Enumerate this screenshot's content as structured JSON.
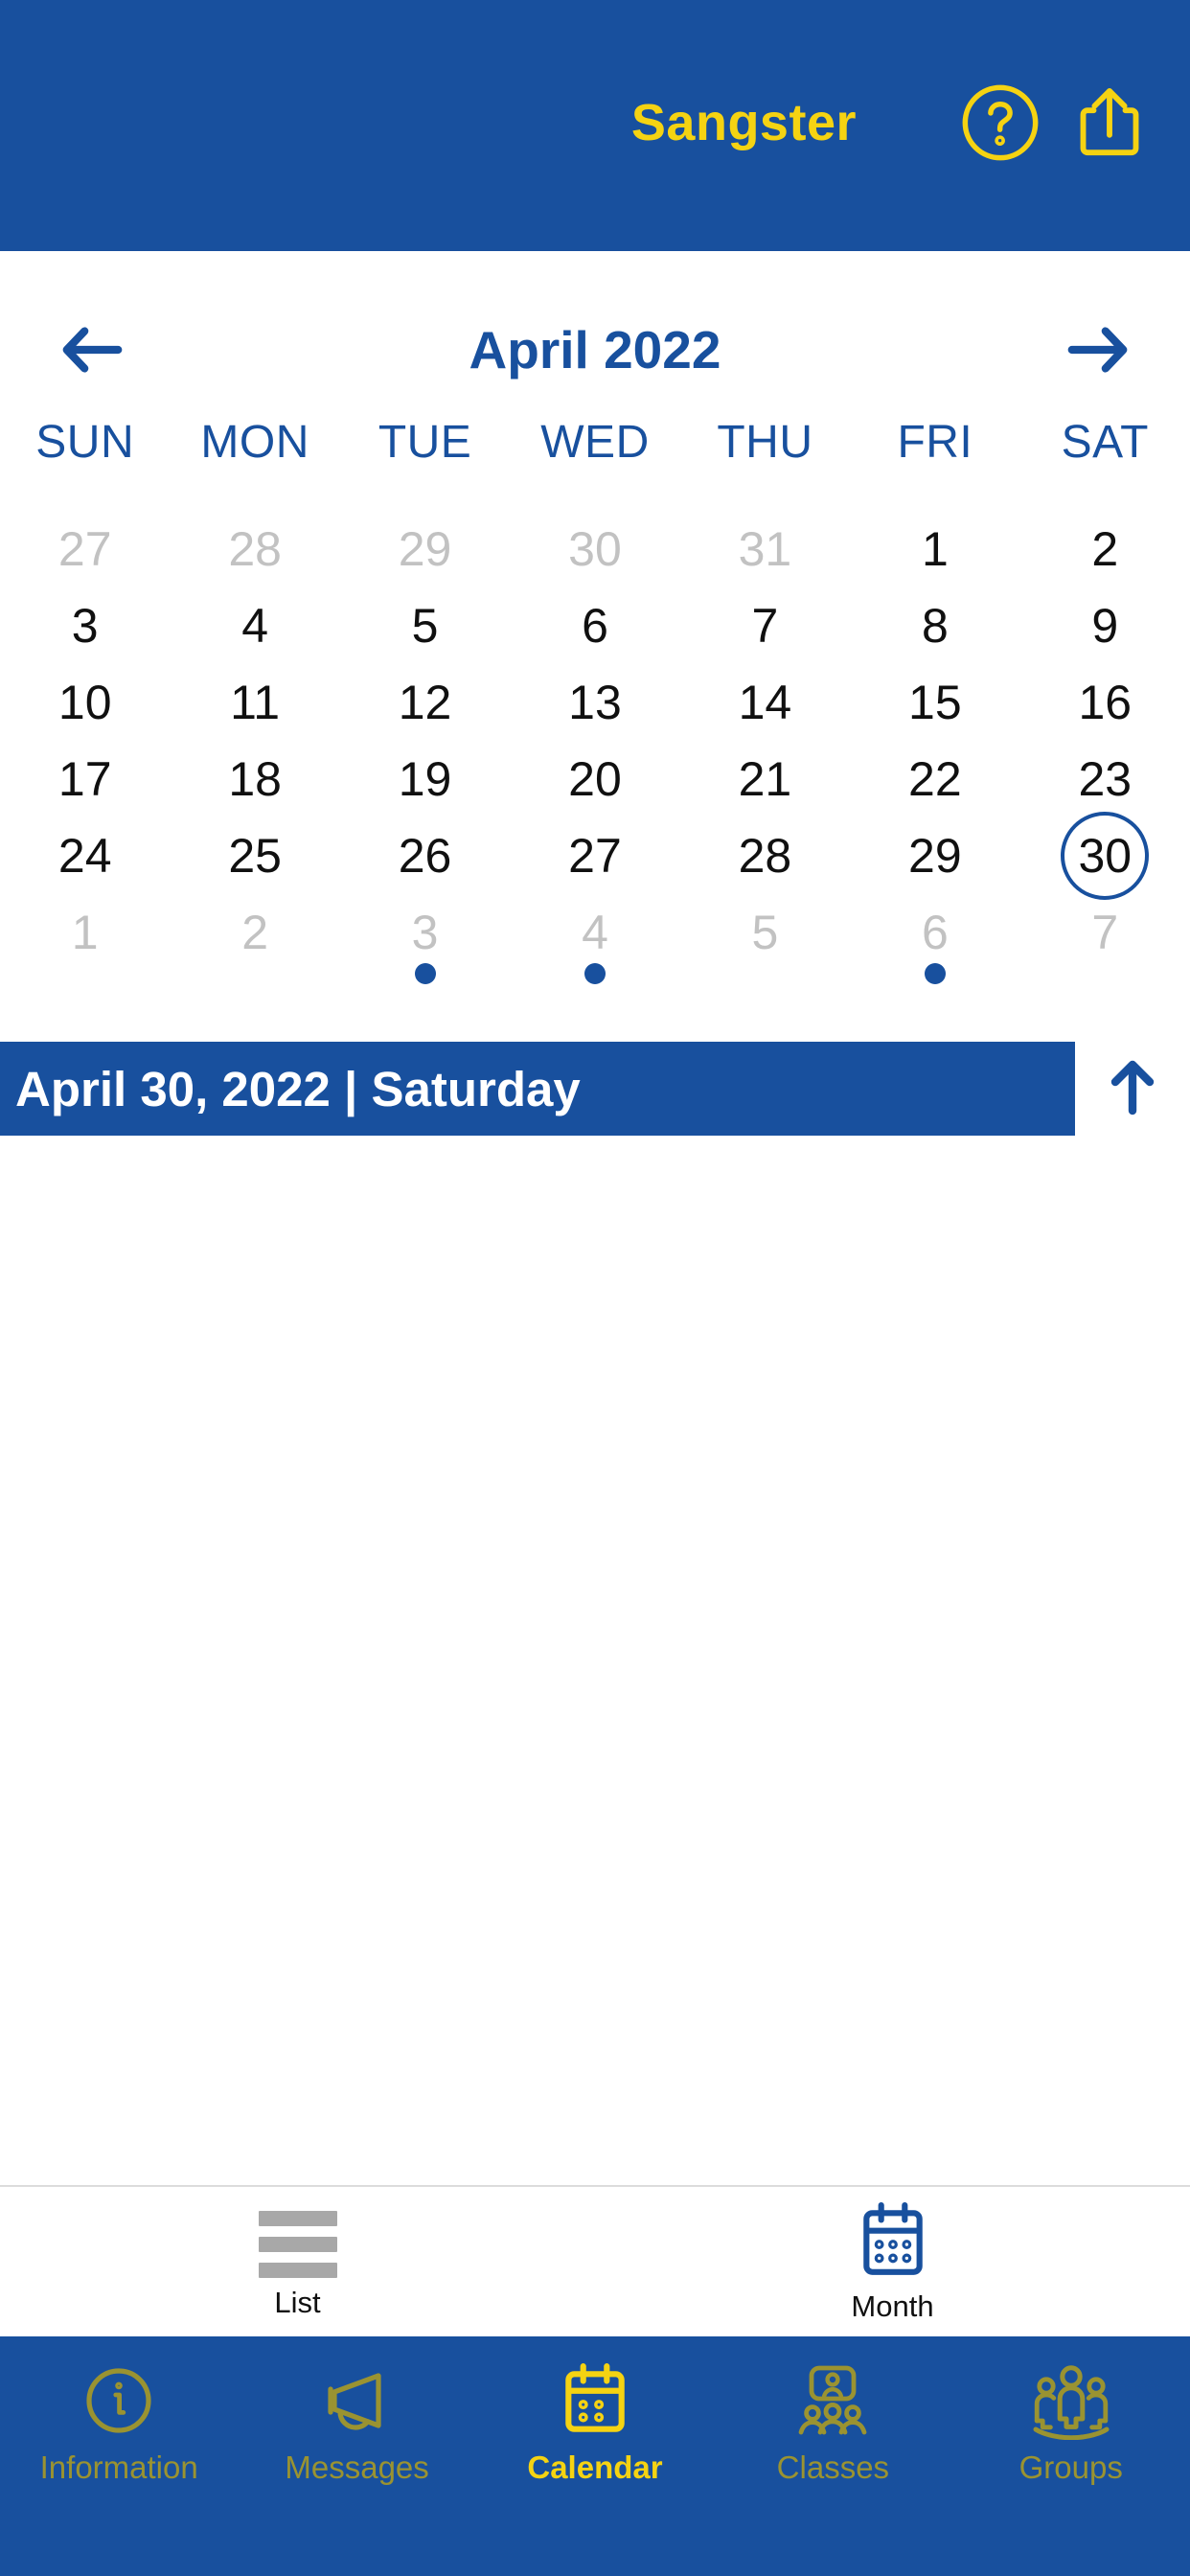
{
  "header": {
    "title": "Sangster",
    "help_icon": "help-circle-icon",
    "share_icon": "share-icon",
    "background_color": "#18509E",
    "accent_color": "#F5D312"
  },
  "calendar": {
    "month_title": "April 2022",
    "prev_label": "←",
    "next_label": "→",
    "weekdays": [
      "SUN",
      "MON",
      "TUE",
      "WED",
      "THU",
      "FRI",
      "SAT"
    ],
    "accent_color": "#18509E",
    "muted_color": "#C2C2C2",
    "weeks": [
      [
        {
          "n": "27",
          "muted": true,
          "selected": false,
          "dot": false
        },
        {
          "n": "28",
          "muted": true,
          "selected": false,
          "dot": false
        },
        {
          "n": "29",
          "muted": true,
          "selected": false,
          "dot": false
        },
        {
          "n": "30",
          "muted": true,
          "selected": false,
          "dot": false
        },
        {
          "n": "31",
          "muted": true,
          "selected": false,
          "dot": false
        },
        {
          "n": "1",
          "muted": false,
          "selected": false,
          "dot": false
        },
        {
          "n": "2",
          "muted": false,
          "selected": false,
          "dot": false
        }
      ],
      [
        {
          "n": "3",
          "muted": false,
          "selected": false,
          "dot": false
        },
        {
          "n": "4",
          "muted": false,
          "selected": false,
          "dot": false
        },
        {
          "n": "5",
          "muted": false,
          "selected": false,
          "dot": false
        },
        {
          "n": "6",
          "muted": false,
          "selected": false,
          "dot": false
        },
        {
          "n": "7",
          "muted": false,
          "selected": false,
          "dot": false
        },
        {
          "n": "8",
          "muted": false,
          "selected": false,
          "dot": false
        },
        {
          "n": "9",
          "muted": false,
          "selected": false,
          "dot": false
        }
      ],
      [
        {
          "n": "10",
          "muted": false,
          "selected": false,
          "dot": false
        },
        {
          "n": "11",
          "muted": false,
          "selected": false,
          "dot": false
        },
        {
          "n": "12",
          "muted": false,
          "selected": false,
          "dot": false
        },
        {
          "n": "13",
          "muted": false,
          "selected": false,
          "dot": false
        },
        {
          "n": "14",
          "muted": false,
          "selected": false,
          "dot": false
        },
        {
          "n": "15",
          "muted": false,
          "selected": false,
          "dot": false
        },
        {
          "n": "16",
          "muted": false,
          "selected": false,
          "dot": false
        }
      ],
      [
        {
          "n": "17",
          "muted": false,
          "selected": false,
          "dot": false
        },
        {
          "n": "18",
          "muted": false,
          "selected": false,
          "dot": false
        },
        {
          "n": "19",
          "muted": false,
          "selected": false,
          "dot": false
        },
        {
          "n": "20",
          "muted": false,
          "selected": false,
          "dot": false
        },
        {
          "n": "21",
          "muted": false,
          "selected": false,
          "dot": false
        },
        {
          "n": "22",
          "muted": false,
          "selected": false,
          "dot": false
        },
        {
          "n": "23",
          "muted": false,
          "selected": false,
          "dot": false
        }
      ],
      [
        {
          "n": "24",
          "muted": false,
          "selected": false,
          "dot": false
        },
        {
          "n": "25",
          "muted": false,
          "selected": false,
          "dot": false
        },
        {
          "n": "26",
          "muted": false,
          "selected": false,
          "dot": false
        },
        {
          "n": "27",
          "muted": false,
          "selected": false,
          "dot": false
        },
        {
          "n": "28",
          "muted": false,
          "selected": false,
          "dot": false
        },
        {
          "n": "29",
          "muted": false,
          "selected": false,
          "dot": false
        },
        {
          "n": "30",
          "muted": false,
          "selected": true,
          "dot": false
        }
      ],
      [
        {
          "n": "1",
          "muted": true,
          "selected": false,
          "dot": false
        },
        {
          "n": "2",
          "muted": true,
          "selected": false,
          "dot": false
        },
        {
          "n": "3",
          "muted": true,
          "selected": false,
          "dot": true
        },
        {
          "n": "4",
          "muted": true,
          "selected": false,
          "dot": true
        },
        {
          "n": "5",
          "muted": true,
          "selected": false,
          "dot": false
        },
        {
          "n": "6",
          "muted": true,
          "selected": false,
          "dot": true
        },
        {
          "n": "7",
          "muted": true,
          "selected": false,
          "dot": false
        }
      ]
    ]
  },
  "selected_date_banner": {
    "text": "April 30, 2022 | Saturday",
    "collapse_icon": "arrow-up-icon",
    "background_color": "#18509E"
  },
  "view_switcher": {
    "items": [
      {
        "label": "List",
        "icon": "list-icon",
        "active": false
      },
      {
        "label": "Month",
        "icon": "calendar-icon",
        "active": true
      }
    ]
  },
  "tabbar": {
    "items": [
      {
        "label": "Information",
        "icon": "info-circle-icon",
        "active": false
      },
      {
        "label": "Messages",
        "icon": "megaphone-icon",
        "active": false
      },
      {
        "label": "Calendar",
        "icon": "calendar-icon",
        "active": true
      },
      {
        "label": "Classes",
        "icon": "classes-icon",
        "active": false
      },
      {
        "label": "Groups",
        "icon": "groups-icon",
        "active": false
      }
    ],
    "active_color": "#F5D312",
    "inactive_color": "#9A9331",
    "background_color": "#18509E"
  }
}
